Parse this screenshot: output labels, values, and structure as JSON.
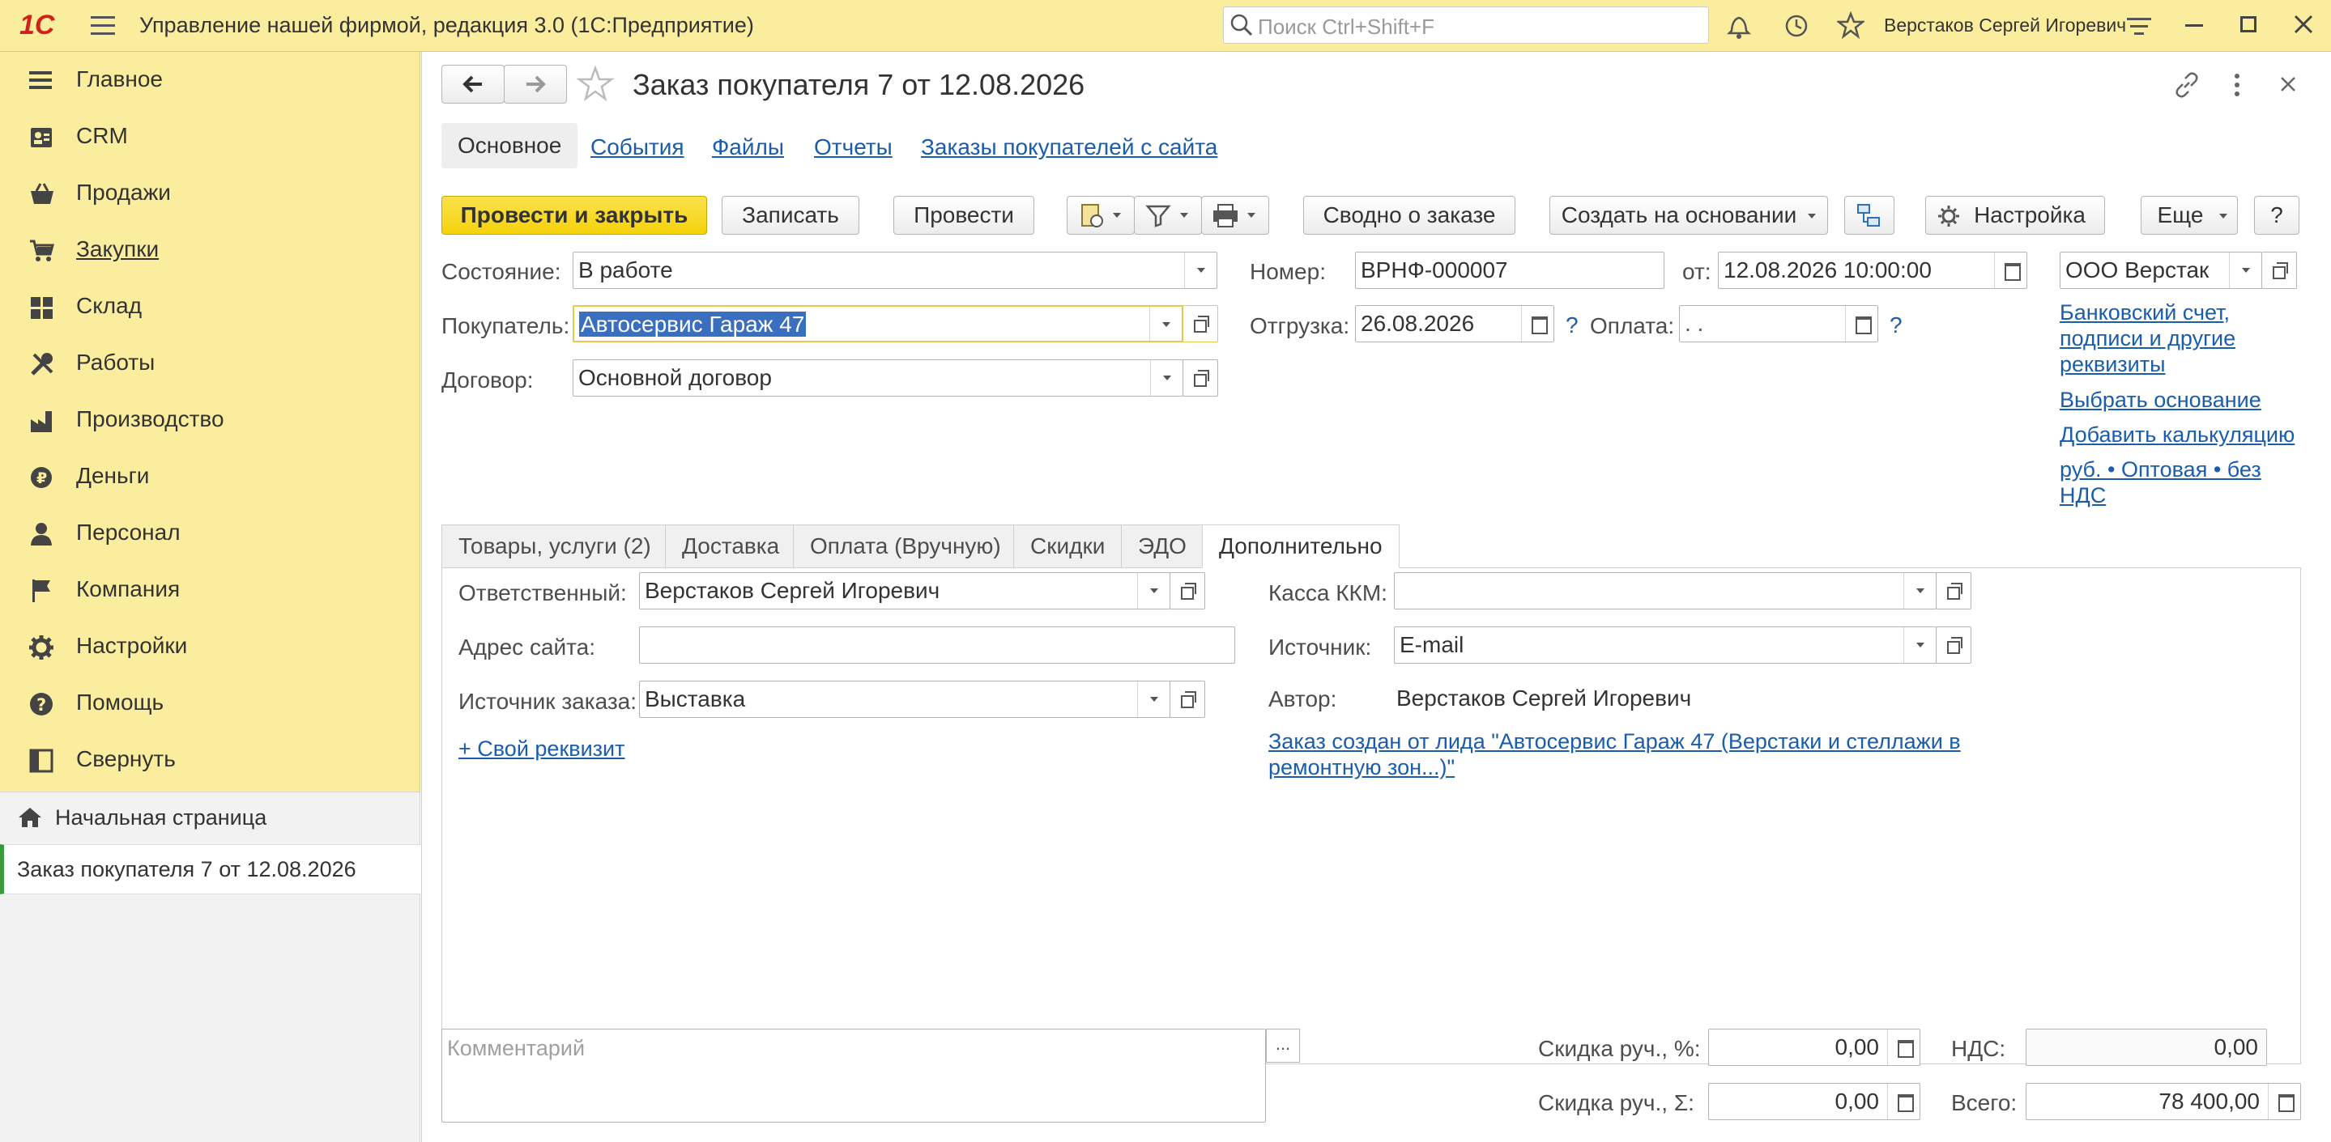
{
  "app": {
    "title": "Управление нашей фирмой, редакция 3.0  (1С:Предприятие)",
    "logo": "1С",
    "search_placeholder": "Поиск Ctrl+Shift+F",
    "user": "Верстаков Сергей Игоревич"
  },
  "sidebar": {
    "items": [
      {
        "label": "Главное",
        "icon": "menu-lines-icon"
      },
      {
        "label": "CRM",
        "icon": "contacts-icon"
      },
      {
        "label": "Продажи",
        "icon": "basket-icon"
      },
      {
        "label": "Закупки",
        "icon": "cart-icon"
      },
      {
        "label": "Склад",
        "icon": "warehouse-icon"
      },
      {
        "label": "Работы",
        "icon": "tools-icon"
      },
      {
        "label": "Производство",
        "icon": "factory-icon"
      },
      {
        "label": "Деньги",
        "icon": "ruble-coin-icon"
      },
      {
        "label": "Персонал",
        "icon": "person-icon"
      },
      {
        "label": "Компания",
        "icon": "flag-icon"
      },
      {
        "label": "Настройки",
        "icon": "gear-icon"
      },
      {
        "label": "Помощь",
        "icon": "help-icon"
      },
      {
        "label": "Свернуть",
        "icon": "collapse-panel-icon"
      }
    ],
    "opened": [
      {
        "label": "Начальная страница",
        "icon": "home-icon"
      },
      {
        "label": "Заказ покупателя 7 от 12.08.2026"
      }
    ]
  },
  "doc": {
    "title": "Заказ покупателя 7 от 12.08.2026",
    "tabs": [
      "Основное",
      "События",
      "Файлы",
      "Отчеты",
      "Заказы покупателей с сайта"
    ],
    "toolbar": {
      "post_close": "Провести и закрыть",
      "save": "Записать",
      "post": "Провести",
      "summary": "Сводно о заказе",
      "create_based": "Создать на основании",
      "settings": "Настройка",
      "more": "Еще",
      "help": "?"
    },
    "fields": {
      "state_label": "Состояние:",
      "state": "В работе",
      "buyer_label": "Покупатель:",
      "buyer": "Автосервис Гараж 47",
      "contract_label": "Договор:",
      "contract": "Основной договор",
      "number_label": "Номер:",
      "number": "ВРНФ-000007",
      "date_label": "от:",
      "date": "12.08.2026 10:00:00",
      "shipment_label": "Отгрузка:",
      "shipment": "26.08.2026",
      "payment_label": "Оплата:",
      "payment": " .  .",
      "company": "ООО Верстак",
      "q": "?"
    },
    "side_links": {
      "bank": "Банковский счет, подписи и другие реквизиты",
      "select_basis": "Выбрать основание",
      "add_calc": "Добавить калькуляцию",
      "price_type": "руб. • Оптовая • без НДС"
    },
    "subtabs": [
      "Товары, услуги (2)",
      "Доставка",
      "Оплата (Вручную)",
      "Скидки",
      "ЭДО",
      "Дополнительно"
    ],
    "extra": {
      "responsible_label": "Ответственный:",
      "responsible": "Верстаков Сергей Игоревич",
      "site_label": "Адрес сайта:",
      "site": "",
      "order_source_label": "Источник заказа:",
      "order_source": "Выставка",
      "custom_attr": "+ Свой реквизит",
      "kkm_label": "Касса ККМ:",
      "kkm": "",
      "source_label": "Источник:",
      "source": "E-mail",
      "author_label": "Автор:",
      "author": "Верстаков Сергей Игоревич",
      "lead_link": "Заказ создан от лида \"Автосервис Гараж 47 (Верстаки и стеллажи в ремонтную зон...)\""
    },
    "footer": {
      "comment_placeholder": "Комментарий",
      "ellipsis": "...",
      "discount_pct_label": "Скидка руч., %:",
      "discount_pct": "0,00",
      "discount_sum_label": "Скидка руч., Σ:",
      "discount_sum": "0,00",
      "vat_label": "НДС:",
      "vat": "0,00",
      "total_label": "Всего:",
      "total": "78 400,00"
    }
  },
  "colors": {
    "accent_yellow": "#fbed9e",
    "button_yellow": "#f5d20a",
    "link": "#1a5dad",
    "logo_red": "#d0221c"
  }
}
